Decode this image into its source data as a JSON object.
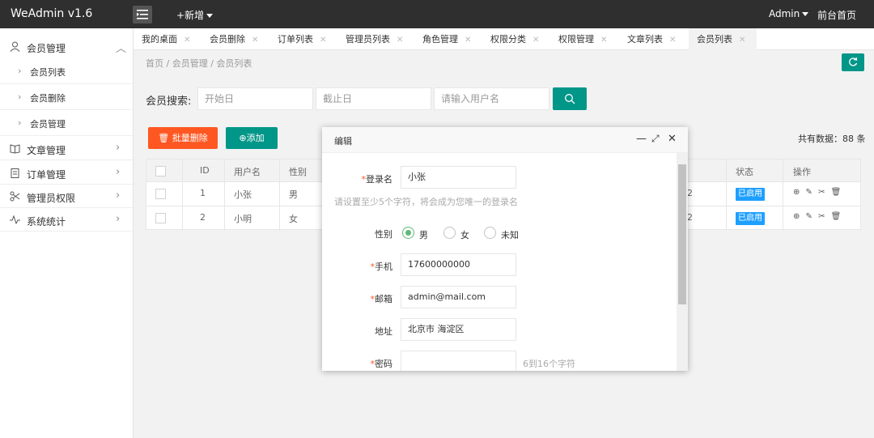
{
  "topbar": {
    "logo": "WeAdmin v1.6",
    "new_label": "+新增",
    "admin_label": "Admin",
    "front_label": "前台首页"
  },
  "sidebar": {
    "groups": [
      {
        "label": "会员管理",
        "icon": "user-icon",
        "expanded": true,
        "children": [
          "会员列表",
          "会员删除",
          "会员管理"
        ]
      },
      {
        "label": "文章管理",
        "icon": "book-icon"
      },
      {
        "label": "订单管理",
        "icon": "clipboard-icon"
      },
      {
        "label": "管理员权限",
        "icon": "scissors-icon"
      },
      {
        "label": "系统统计",
        "icon": "pulse-icon"
      }
    ]
  },
  "tabs": [
    "我的桌面",
    "会员删除",
    "订单列表",
    "管理员列表",
    "角色管理",
    "权限分类",
    "权限管理",
    "文章列表",
    "会员列表"
  ],
  "active_tab": 8,
  "breadcrumb": [
    "首页",
    "会员管理",
    "会员列表"
  ],
  "search": {
    "label": "会员搜索:",
    "start_placeholder": "开始日",
    "end_placeholder": "截止日",
    "user_placeholder": "请输入用户名"
  },
  "toolbar": {
    "batch_delete": "批量删除",
    "add": "添加",
    "total": "共有数据：88 条"
  },
  "table": {
    "headers": [
      "ID",
      "用户名",
      "性别",
      "状态",
      "操作"
    ],
    "rows": [
      {
        "id": "1",
        "name": "小张",
        "gender": "男",
        "hidden_tail": "2",
        "status": "已启用"
      },
      {
        "id": "2",
        "name": "小明",
        "gender": "女",
        "hidden_tail": "2",
        "status": "已启用"
      }
    ],
    "ops_icons": "⊕ ✎ ✂ 🗑"
  },
  "modal": {
    "title": "编辑",
    "fields": {
      "login_label": "登录名",
      "login_value": "小张",
      "login_hint": "请设置至少5个字符，将会成为您唯一的登录名",
      "gender_label": "性别",
      "gender_options": [
        "男",
        "女",
        "未知"
      ],
      "gender_selected": 0,
      "phone_label": "手机",
      "phone_value": "17600000000",
      "email_label": "邮箱",
      "email_value": "admin@mail.com",
      "address_label": "地址",
      "address_value": "北京市 海淀区",
      "password_label": "密码",
      "password_value": "",
      "password_hint": "6到16个字符"
    },
    "controls": {
      "minimize": "—",
      "maximize": "⤢",
      "close": "✕"
    }
  },
  "colors": {
    "topbar": "#2f2f2f",
    "primary": "#009688",
    "danger": "#ff5722",
    "badge": "#1e9fff",
    "radio": "#5fb878"
  }
}
